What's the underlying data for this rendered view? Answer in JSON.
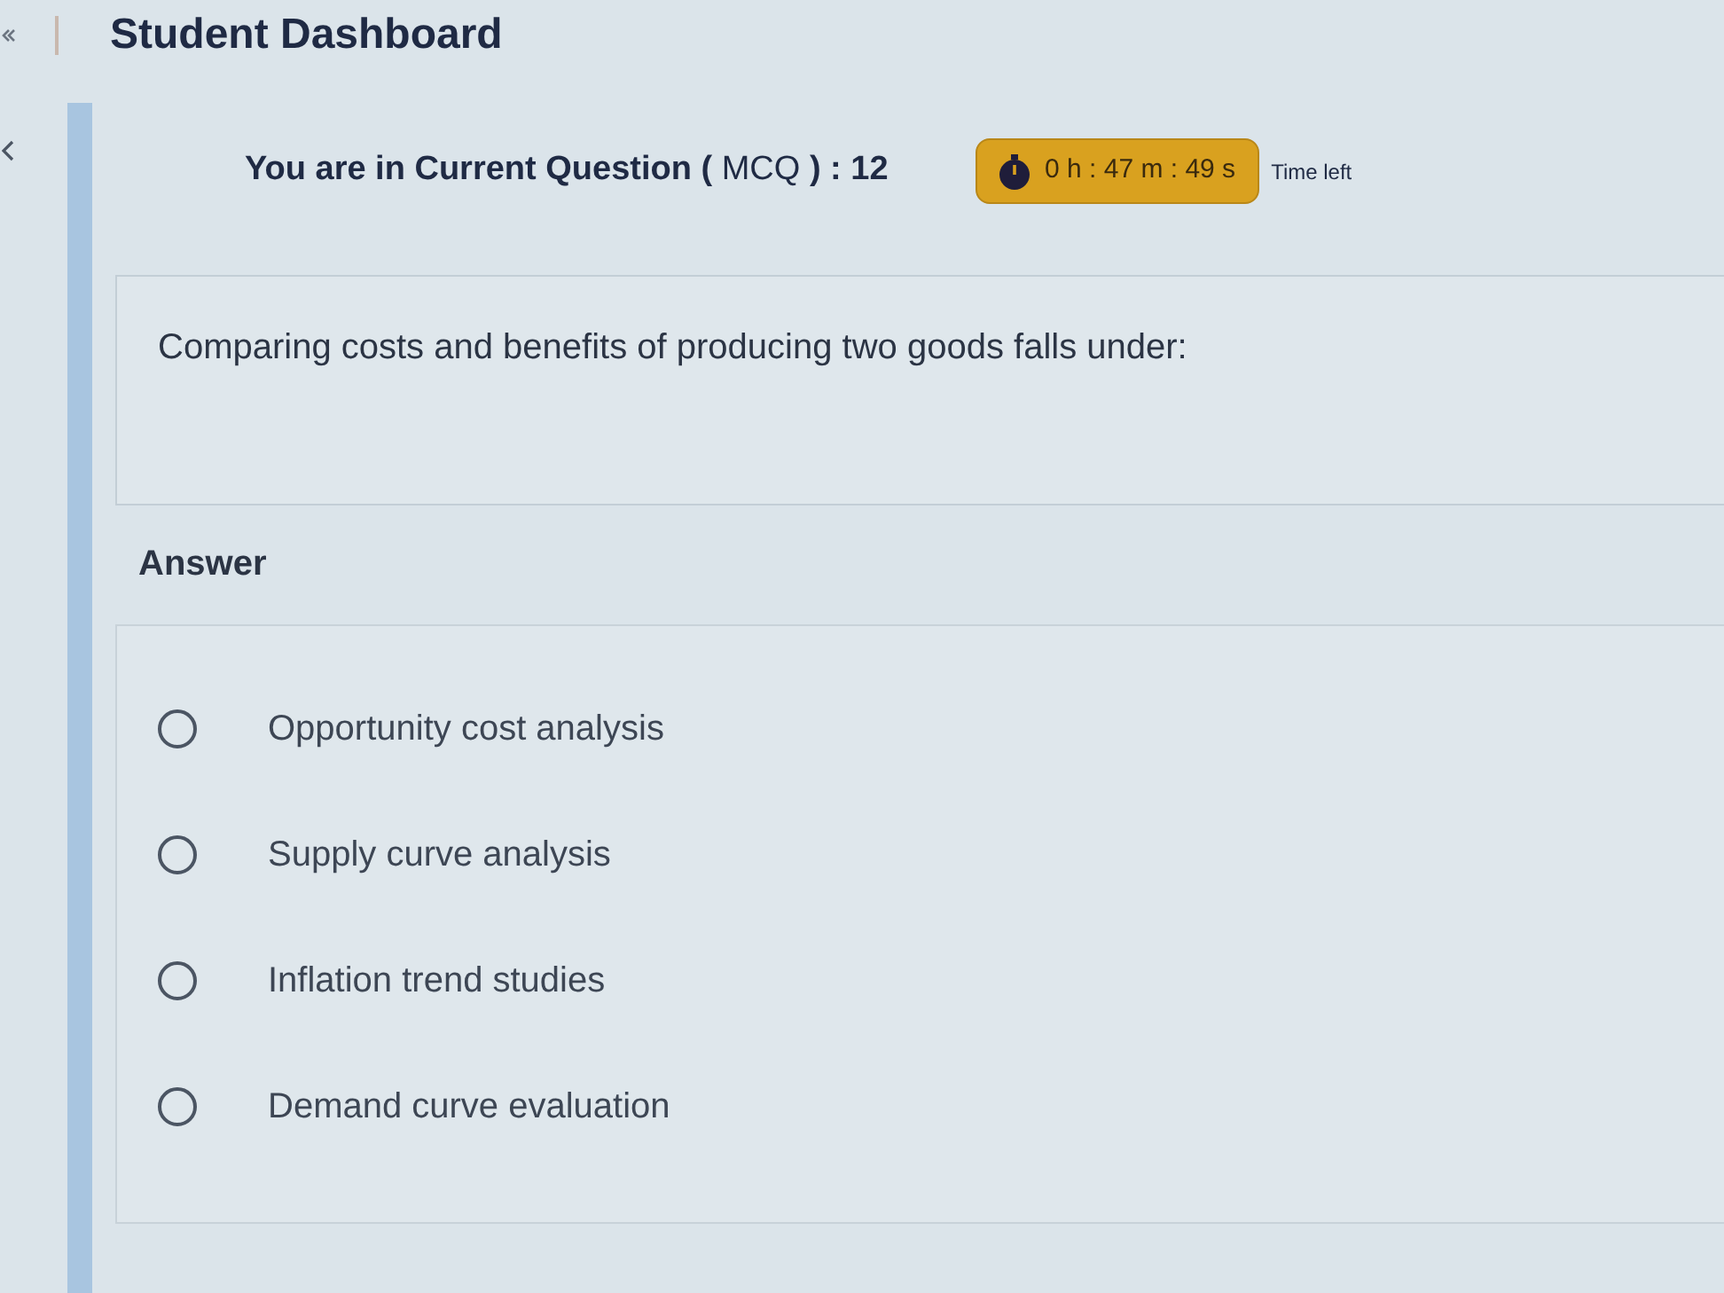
{
  "header": {
    "title": "Student Dashboard"
  },
  "current_question": {
    "text": "**You are in Current Question (** MCQ **) : 12**"
  },
  "timer": {
    "text": "0 h : 47 m : 49 s",
    "label": "Time left"
  },
  "question": {
    "text": "Comparing costs and benefits of producing two goods falls under:"
  },
  "answer": {
    "heading": "Answer",
    "options": [
      {
        "label": "Opportunity cost analysis",
        "selected": false
      },
      {
        "label": "Supply curve analysis",
        "selected": false
      },
      {
        "label": "Inflation trend studies",
        "selected": false
      },
      {
        "label": "Demand curve evaluation",
        "selected": false
      }
    ]
  }
}
